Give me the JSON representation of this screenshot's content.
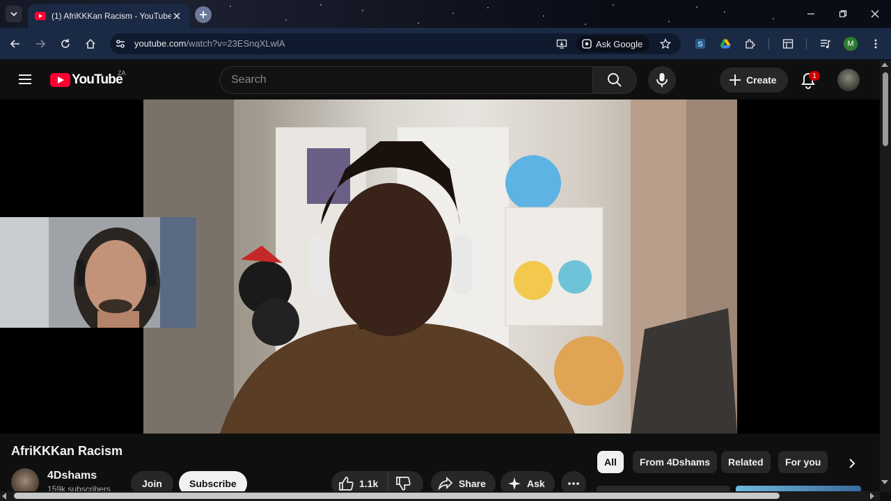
{
  "browser": {
    "tab_title": "(1) AfriKKKan Racism - YouTube",
    "url_domain": "youtube.com",
    "url_path": "/watch?v=23ESnqXLwlA",
    "ask_google_label": "Ask Google",
    "profile_initial": "M"
  },
  "youtube": {
    "logo_text": "YouTube",
    "country_code": "ZA",
    "search_placeholder": "Search",
    "create_label": "Create",
    "notification_count": "1"
  },
  "video": {
    "title": "AfriKKKan Racism",
    "channel_name": "4Dshams",
    "channel_subscribers": "159k subscribers",
    "join_label": "Join",
    "subscribe_label": "Subscribe",
    "like_count": "1.1k",
    "share_label": "Share",
    "ask_label": "Ask"
  },
  "chips": [
    {
      "label": "All",
      "active": true
    },
    {
      "label": "From 4Dshams",
      "active": false
    },
    {
      "label": "Related",
      "active": false
    },
    {
      "label": "For you",
      "active": false
    }
  ],
  "colors": {
    "accent_red": "#ff0033",
    "browser_frame": "#1b2a44",
    "yt_background": "#0f0f0f"
  }
}
